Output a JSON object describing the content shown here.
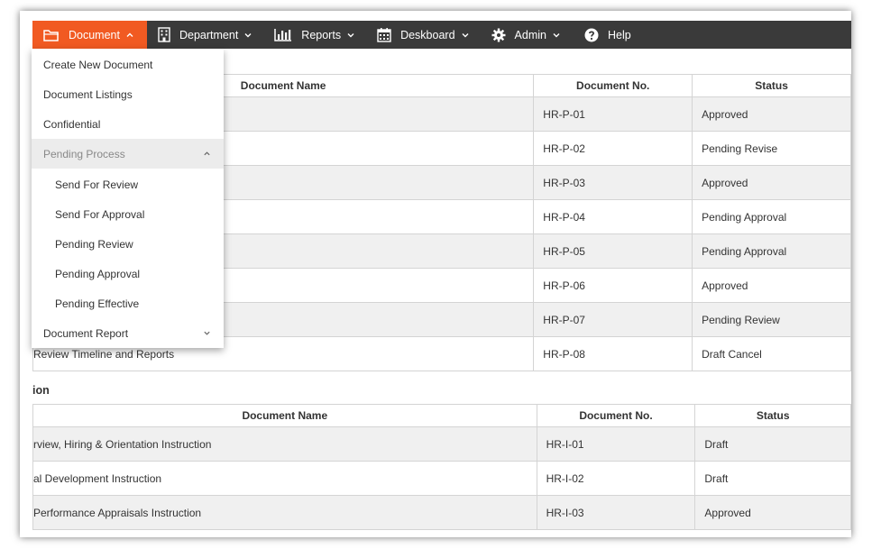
{
  "navbar": {
    "items": [
      {
        "label": "Document",
        "icon": "folder-icon",
        "active": true
      },
      {
        "label": "Department",
        "icon": "building-icon"
      },
      {
        "label": "Reports",
        "icon": "bar-chart-icon"
      },
      {
        "label": "Deskboard",
        "icon": "calendar-icon"
      },
      {
        "label": "Admin",
        "icon": "gear-icon"
      },
      {
        "label": "Help",
        "icon": "question-circle-icon"
      }
    ],
    "accent_color": "#f15a22",
    "bar_color": "#3a3a3a"
  },
  "dropdown": {
    "items": [
      {
        "label": "Create New Document"
      },
      {
        "label": "Document Listings"
      },
      {
        "label": "Confidential"
      },
      {
        "label": "Pending Process"
      },
      {
        "label": "Send For Review"
      },
      {
        "label": "Send For Approval"
      },
      {
        "label": "Pending Review"
      },
      {
        "label": "Pending Approval"
      },
      {
        "label": "Pending Effective"
      },
      {
        "label": "Document Report"
      }
    ]
  },
  "table1": {
    "headers": [
      "Document Name",
      "Document No.",
      "Status"
    ],
    "rows": [
      {
        "name": "",
        "no": "HR-P-01",
        "status": "Approved"
      },
      {
        "name": "",
        "no": "HR-P-02",
        "status": "Pending Revise"
      },
      {
        "name": "",
        "no": "HR-P-03",
        "status": "Approved"
      },
      {
        "name": "",
        "no": "HR-P-04",
        "status": "Pending Approval"
      },
      {
        "name": "",
        "no": "HR-P-05",
        "status": "Pending Approval"
      },
      {
        "name": "",
        "no": "HR-P-06",
        "status": "Approved"
      },
      {
        "name": "",
        "no": "HR-P-07",
        "status": "Pending Review"
      },
      {
        "name": "Review Timeline and Reports",
        "no": "HR-P-08",
        "status": "Draft Cancel"
      }
    ]
  },
  "section2": {
    "title": "ion"
  },
  "table2": {
    "headers": [
      "Document Name",
      "Document No.",
      "Status"
    ],
    "rows": [
      {
        "name": "rview, Hiring & Orientation Instruction",
        "no": "HR-I-01",
        "status": "Draft"
      },
      {
        "name": "al Development Instruction",
        "no": "HR-I-02",
        "status": "Draft"
      },
      {
        "name": "Performance Appraisals Instruction",
        "no": "HR-I-03",
        "status": "Approved"
      }
    ]
  }
}
